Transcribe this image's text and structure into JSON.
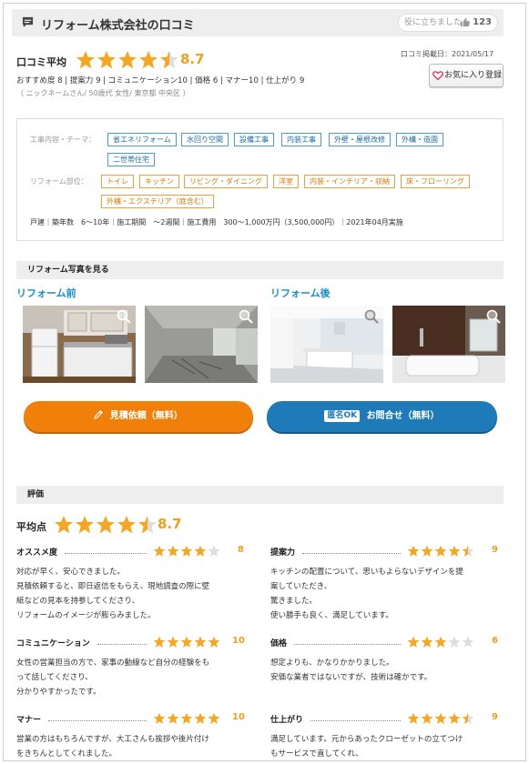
{
  "header": {
    "title": "リフォーム株式会社の口コミ",
    "helpful_label": "役に立ちました",
    "helpful_count": "123"
  },
  "review": {
    "avg_label": "口コミ平均",
    "avg_score": "8.7",
    "avg_stars": 4.5,
    "date": "口コミ掲載日：2021/05/17",
    "favorite_label": "お気に入り登録",
    "subscores": "おすすめ度 8 | 提案力 9 | コミュニケーション10 | 価格 6 | マナー10 | 仕上がり 9",
    "user": "（ ニックネームさん/ 50歳代 女性/ 東京都 中央区 ）"
  },
  "info": {
    "work_label": "工事内容・テーマ：",
    "work_tags": [
      "省エネリフォーム",
      "水回り空間",
      "設備工事",
      "内装工事",
      "外壁・屋根改修",
      "外構・造園",
      "二世帯住宅"
    ],
    "part_label": "リフォーム部位：",
    "part_tags": [
      "トイレ",
      "キッチン",
      "リビング・ダイニング",
      "洋室",
      "内装・インテリア・収納",
      "床・フローリング",
      "外構・エクステリア（庭含む）"
    ],
    "spec": "戸建｜築年数　6〜10年｜施工期間　〜2週間｜施工費用　300〜1,000万円（3,500,000円）｜2021年04月実施"
  },
  "photos": {
    "section_title": "リフォーム写真を見る",
    "before_label": "リフォーム前",
    "after_label": "リフォーム後"
  },
  "buttons": {
    "estimate": "見積依頼（無料）",
    "anon_badge": "匿名OK",
    "inquiry": "お問合せ（無料）"
  },
  "rating": {
    "section_title": "評価",
    "avg_label": "平均点",
    "avg_score": "8.7",
    "avg_stars": 4.5,
    "categories": [
      {
        "name": "オススメ度",
        "score": "8",
        "stars": 4,
        "text": "対応が早く、安心できました。\n見積依頼すると、即日返信をもらえ、現地調査の際に壁\n紙などの見本を持参してくださり、\nリフォームのイメージが膨らみました。"
      },
      {
        "name": "提案力",
        "score": "9",
        "stars": 4.5,
        "text": "キッチンの配置について、思いもよらないデザインを提\n案していただき、\n驚きました。\n使い勝手も良く、満足しています。"
      },
      {
        "name": "コミュニケーション",
        "score": "10",
        "stars": 5,
        "text": "女性の営業担当の方で、家事の動線など自分の経験をも\nって話してくださり、\n分かりやすかったです。"
      },
      {
        "name": "価格",
        "score": "6",
        "stars": 3,
        "text": "想定よりも、かなりかかりました。\n安価な業者ではないですが、技術は確かです。"
      },
      {
        "name": "マナー",
        "score": "10",
        "stars": 5,
        "text": "営業の方はもちろんですが、大工さんも挨拶や後片付け\nをきちんとしてくれました。"
      },
      {
        "name": "仕上がり",
        "score": "9",
        "stars": 4.5,
        "text": "満足しています。元からあったクローゼットの立てつけ\nもサービスで直してくれ、"
      }
    ]
  },
  "colors": {
    "star": "#f5a623",
    "star_empty": "#dddddd",
    "accent_blue": "#1a8ccc",
    "orange_button": "#f0800a",
    "blue_button": "#1e7ab8"
  }
}
